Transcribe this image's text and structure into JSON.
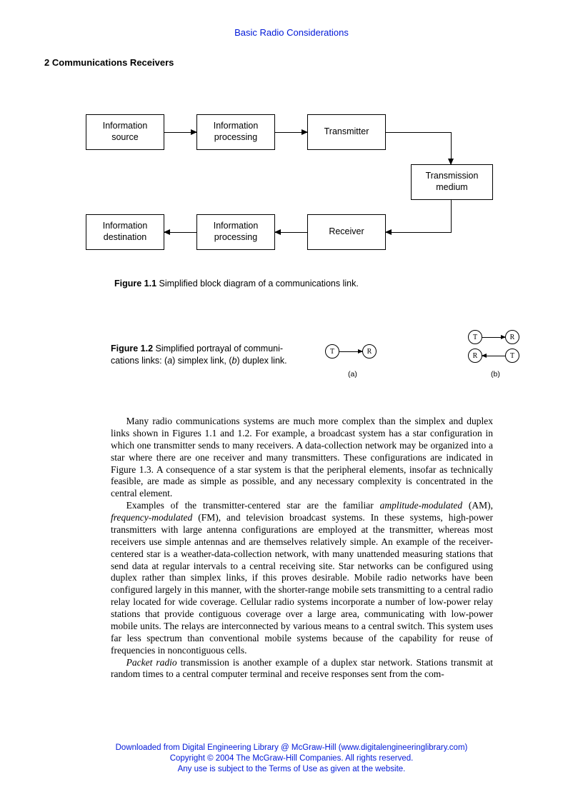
{
  "header": {
    "title": "Basic Radio Considerations"
  },
  "section": {
    "number": "2",
    "title": "Communications Receivers"
  },
  "figure1": {
    "boxes": {
      "info_source": "Information\nsource",
      "info_proc_top": "Information\nprocessing",
      "transmitter": "Transmitter",
      "trans_medium": "Transmission\nmedium",
      "receiver": "Receiver",
      "info_proc_bot": "Information\nprocessing",
      "info_dest": "Information\ndestination"
    },
    "caption_label": "Figure 1.1",
    "caption_text": " Simplified block diagram of a communications link."
  },
  "figure2": {
    "caption_label": "Figure 1.2",
    "caption_text_1": " Simplified portrayal of communi-",
    "caption_text_2": "cations links: (",
    "caption_a": "a",
    "caption_text_3": ") simplex link, (",
    "caption_b": "b",
    "caption_text_4": ") duplex link.",
    "nodes": {
      "T": "T",
      "R": "R"
    },
    "labels": {
      "a": "(a)",
      "b": "(b)"
    }
  },
  "body": {
    "p1_a": "Many radio communications systems are much more complex than the simplex and duplex links shown in Figures 1.1 and 1.2. For example, a broadcast system has a star configuration in which one transmitter sends to many receivers. A data-collection network may be organized into a star where there are one receiver and many transmitters. These configurations are indicated in Figure 1.3. A consequence of a star system is that the peripheral elements, insofar as technically feasible, are made as simple as possible, and any necessary complexity is concentrated in the central element.",
    "p2_a": "Examples of the transmitter-centered star are the familiar ",
    "p2_am": "amplitude-modulated",
    "p2_b": " (AM), ",
    "p2_fm": "frequency-modulated",
    "p2_c": " (FM), and television broadcast systems. In these systems, high-power transmitters with large antenna configurations are employed at the transmitter, whereas most receivers use simple antennas and are themselves relatively simple. An example of the receiver-centered star is a weather-data-collection network, with many unattended measuring stations that send data at regular intervals to a central receiving site. Star networks can be configured using duplex rather than simplex links, if this proves desirable. Mobile radio networks have been configured largely in this manner, with the shorter-range mobile sets transmitting to a central radio relay located for wide coverage. Cellular radio systems incorporate a number of low-power relay stations that provide contiguous coverage over a large area, communicating with low-power mobile units. The relays are interconnected by various means to a central switch. This system uses far less spectrum than conventional mobile systems because of the capability for reuse of frequencies in noncontiguous cells.",
    "p3_pr": "Packet radio",
    "p3_a": " transmission is another example of a duplex star network. Stations transmit at random times to a central computer terminal and receive responses sent from the com-"
  },
  "footer": {
    "line1": "Downloaded from Digital Engineering Library @ McGraw-Hill (www.digitalengineeringlibrary.com)",
    "line2": "Copyright © 2004 The McGraw-Hill Companies. All rights reserved.",
    "line3": "Any use is subject to the Terms of Use as given at the website."
  }
}
